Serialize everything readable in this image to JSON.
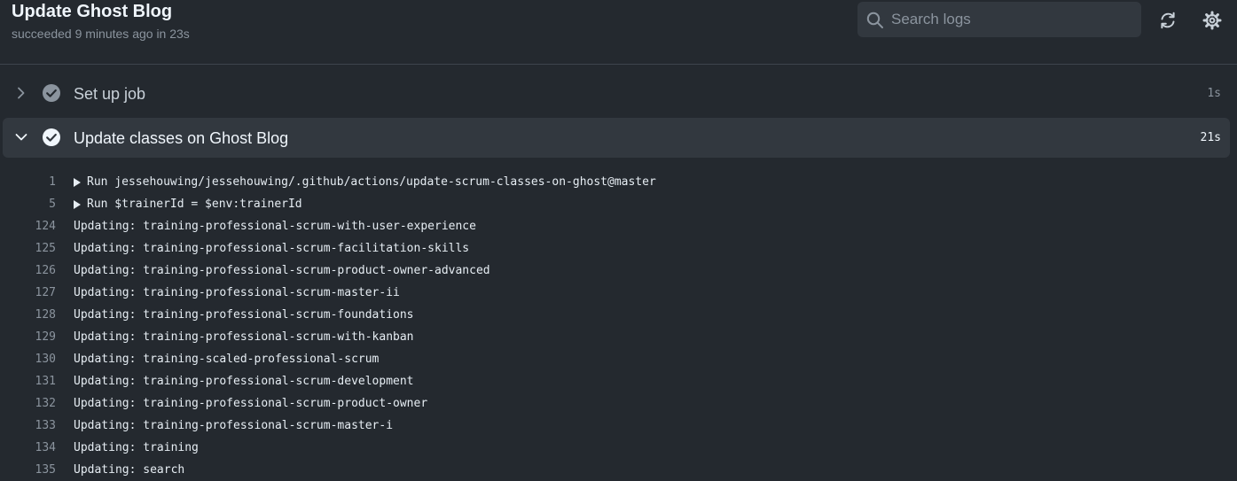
{
  "header": {
    "title": "Update Ghost Blog",
    "status": "succeeded 9 minutes ago in 23s",
    "search_placeholder": "Search logs",
    "search_icon": "search-icon",
    "refresh_icon": "refresh-icon",
    "settings_icon": "gear-icon"
  },
  "steps": [
    {
      "name": "Set up job",
      "duration": "1s",
      "expanded": false,
      "status": "success"
    },
    {
      "name": "Update classes on Ghost Blog",
      "duration": "21s",
      "expanded": true,
      "status": "success"
    }
  ],
  "log": [
    {
      "num": "1",
      "text": "Run jessehouwing/jessehouwing/.github/actions/update-scrum-classes-on-ghost@master",
      "group": true
    },
    {
      "num": "5",
      "text": "Run $trainerId = $env:trainerId",
      "group": true
    },
    {
      "num": "124",
      "text": "Updating: training-professional-scrum-with-user-experience",
      "group": false
    },
    {
      "num": "125",
      "text": "Updating: training-professional-scrum-facilitation-skills",
      "group": false
    },
    {
      "num": "126",
      "text": "Updating: training-professional-scrum-product-owner-advanced",
      "group": false
    },
    {
      "num": "127",
      "text": "Updating: training-professional-scrum-master-ii",
      "group": false
    },
    {
      "num": "128",
      "text": "Updating: training-professional-scrum-foundations",
      "group": false
    },
    {
      "num": "129",
      "text": "Updating: training-professional-scrum-with-kanban",
      "group": false
    },
    {
      "num": "130",
      "text": "Updating: training-scaled-professional-scrum",
      "group": false
    },
    {
      "num": "131",
      "text": "Updating: training-professional-scrum-development",
      "group": false
    },
    {
      "num": "132",
      "text": "Updating: training-professional-scrum-product-owner",
      "group": false
    },
    {
      "num": "133",
      "text": "Updating: training-professional-scrum-master-i",
      "group": false
    },
    {
      "num": "134",
      "text": "Updating: training",
      "group": false
    },
    {
      "num": "135",
      "text": "Updating: search",
      "group": false
    }
  ],
  "colors": {
    "background": "#24292f",
    "expanded_row": "#32383f",
    "success_collapsed": "#8b949e",
    "success_expanded": "#f0f6fc"
  }
}
